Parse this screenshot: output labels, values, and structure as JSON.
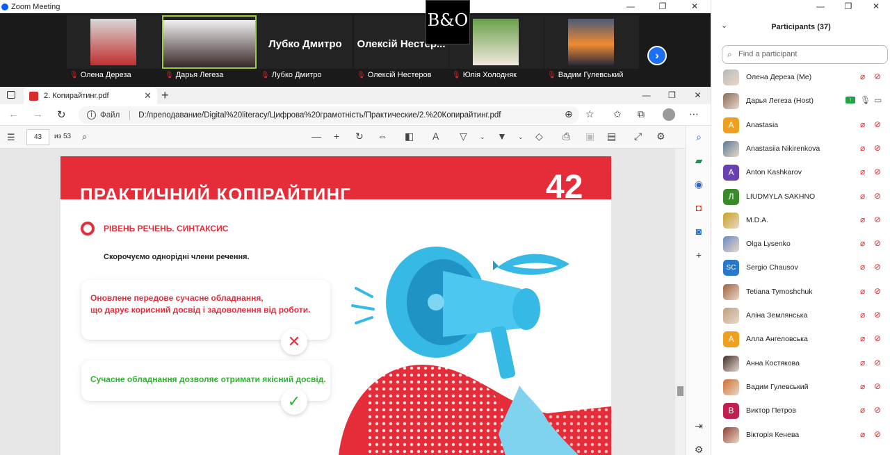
{
  "zoom": {
    "window_title": "Zoom Meeting",
    "bo_logo": "B&O",
    "next_arrow": "›",
    "gallery": [
      {
        "name": "Олена Дереза",
        "label": "Олена Дереза",
        "has_video": true,
        "active": false
      },
      {
        "name": "Дарья Легеза",
        "label": "Дарья Легеза",
        "has_video": true,
        "active": true
      },
      {
        "name": "Лубко Дмитро",
        "label": "Лубко Дмитро",
        "has_video": false,
        "active": false
      },
      {
        "name": "Олексій Нестер...",
        "label": "Олексій Нестеров",
        "has_video": false,
        "active": false
      },
      {
        "name": "Юлія Холодняк",
        "label": "Юлія Холодняк",
        "has_video": true,
        "active": false
      },
      {
        "name": "Вадим Гулевський",
        "label": "Вадим Гулевський",
        "has_video": true,
        "active": false
      }
    ]
  },
  "browser": {
    "tab_title": "2. Копирайтинг.pdf",
    "url_label": "Файл",
    "url": "D:/преподавание/Digital%20literacy/Цифрова%20грамотність/Практические/2.%20Копирайтинг.pdf",
    "page_current": "43",
    "page_total": "из 53"
  },
  "slide": {
    "title": "ПРАКТИЧНИЙ КОПІРАЙТИНГ",
    "number": "42",
    "section": "РІВЕНЬ РЕЧЕНЬ. СИНТАКСИС",
    "subtitle": "Скорочуємо однорідні члени речення.",
    "bad_line1": "Оновлене передове сучасне обладнання,",
    "bad_line2": "що дарує корисний досвід і задоволення від роботи.",
    "good_line": "Сучасне обладнання дозволяє отримати якісний досвід.",
    "mark_wrong": "✕",
    "mark_right": "✓"
  },
  "panel": {
    "title": "Participants (37)",
    "search_placeholder": "Find a participant",
    "participants": [
      {
        "name": "Олена Дереза (Me)",
        "initial": "",
        "color": "#b9b9b9",
        "photo": true,
        "mic_on": false,
        "cam_on": false,
        "sharing": false
      },
      {
        "name": "Дарья Легеза (Host)",
        "initial": "",
        "color": "#8a6a5a",
        "photo": true,
        "mic_on": true,
        "cam_on": true,
        "sharing": true
      },
      {
        "name": "Anastasia",
        "initial": "A",
        "color": "#f0a020",
        "photo": false,
        "mic_on": false,
        "cam_on": false,
        "sharing": false
      },
      {
        "name": "Anastasiia Nikirenkova",
        "initial": "",
        "color": "#5a7a9a",
        "photo": true,
        "mic_on": false,
        "cam_on": false,
        "sharing": false
      },
      {
        "name": "Anton Kashkarov",
        "initial": "A",
        "color": "#6a3fb0",
        "photo": false,
        "mic_on": false,
        "cam_on": false,
        "sharing": false
      },
      {
        "name": "LIUDMYLA SAKHNO",
        "initial": "Л",
        "color": "#3a8a2a",
        "photo": false,
        "mic_on": false,
        "cam_on": false,
        "sharing": false
      },
      {
        "name": "M.D.A.",
        "initial": "",
        "color": "#c8a020",
        "photo": true,
        "mic_on": false,
        "cam_on": false,
        "sharing": false
      },
      {
        "name": "Olga Lysenko",
        "initial": "",
        "color": "#6a8ac0",
        "photo": true,
        "mic_on": false,
        "cam_on": false,
        "sharing": false
      },
      {
        "name": "Sergio Chausov",
        "initial": "SC",
        "color": "#2a78c8",
        "photo": false,
        "mic_on": false,
        "cam_on": false,
        "sharing": false
      },
      {
        "name": "Tetiana Tymoshchuk",
        "initial": "",
        "color": "#a06040",
        "photo": true,
        "mic_on": false,
        "cam_on": false,
        "sharing": false
      },
      {
        "name": "Аліна Землянська",
        "initial": "",
        "color": "#c0a080",
        "photo": true,
        "mic_on": false,
        "cam_on": false,
        "sharing": false
      },
      {
        "name": "Алла Ангеловська",
        "initial": "A",
        "color": "#f0a020",
        "photo": false,
        "mic_on": false,
        "cam_on": false,
        "sharing": false
      },
      {
        "name": "Анна Костякова",
        "initial": "",
        "color": "#403030",
        "photo": true,
        "mic_on": false,
        "cam_on": false,
        "sharing": false
      },
      {
        "name": "Вадим Гулевський",
        "initial": "",
        "color": "#d07030",
        "photo": true,
        "mic_on": false,
        "cam_on": false,
        "sharing": false
      },
      {
        "name": "Виктор Петров",
        "initial": "B",
        "color": "#c02050",
        "photo": false,
        "mic_on": false,
        "cam_on": false,
        "sharing": false
      },
      {
        "name": "Вікторія Кенева",
        "initial": "",
        "color": "#904030",
        "photo": true,
        "mic_on": false,
        "cam_on": false,
        "sharing": false
      }
    ]
  },
  "icons": {
    "mic_muted": "mic-muted-icon",
    "cam_off": "camera-off-icon",
    "search": "search-icon"
  }
}
